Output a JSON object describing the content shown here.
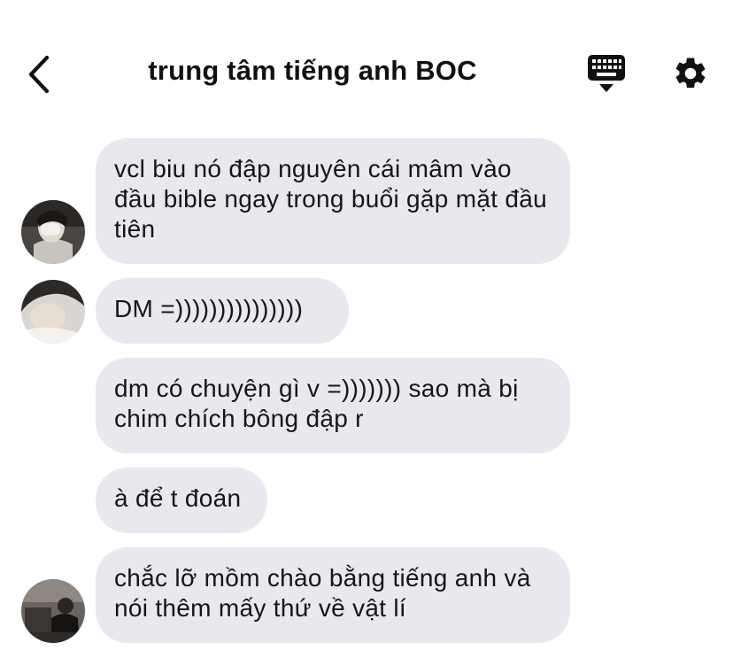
{
  "header": {
    "title": "trung tâm tiếng anh BOC",
    "back_icon": "chevron-left-icon",
    "keyboard_icon": "keyboard-icon",
    "settings_icon": "gear-icon"
  },
  "messages": [
    {
      "text": "vcl biu nó đập nguyên cái mâm vào đầu bible ngay trong buổi gặp mặt đầu tiên",
      "avatar": true
    },
    {
      "text": "DM =)))))))))))))))",
      "avatar": true
    },
    {
      "text": "dm có chuyện gì v =))))))) sao mà bị chim chích bông đập r",
      "avatar": false
    },
    {
      "text": "à để t đoán",
      "avatar": false
    },
    {
      "text": "chắc lỡ mồm chào bằng tiếng anh và nói thêm mấy thứ về vật lí",
      "avatar": true
    }
  ],
  "colors": {
    "bubble": "#e8e9ee",
    "text": "#161616",
    "background": "#ffffff"
  }
}
